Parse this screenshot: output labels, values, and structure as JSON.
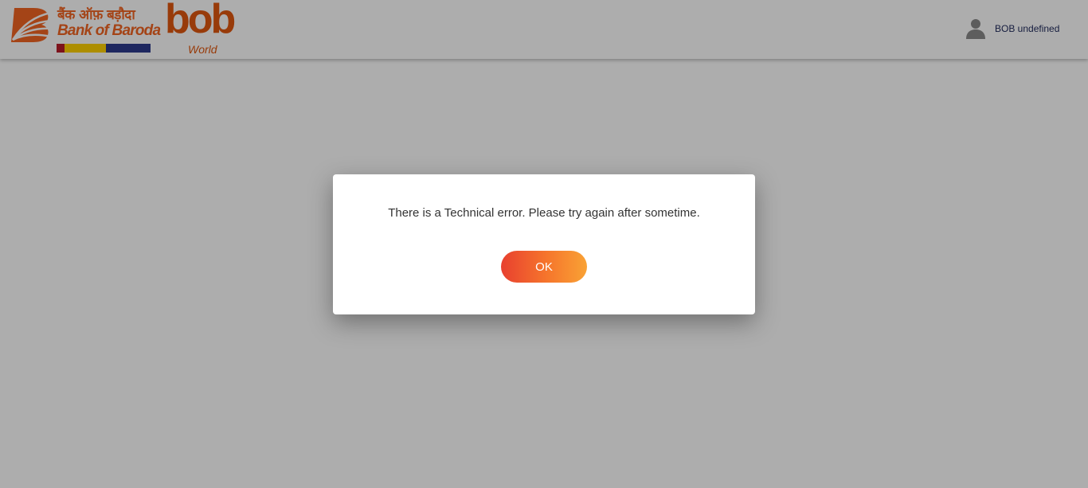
{
  "header": {
    "bank_name_hindi": "बैंक ऑफ़ बड़ौदा",
    "bank_name_english": "Bank of Baroda",
    "brand_word": "bob",
    "brand_sub": "World",
    "user_name": "BOB undefined",
    "brand_color": "#f26522"
  },
  "modal": {
    "message": "There is a Technical error. Please try again after sometime.",
    "ok_label": "OK",
    "button_gradient": [
      "#e8402f",
      "#f9a235"
    ]
  }
}
